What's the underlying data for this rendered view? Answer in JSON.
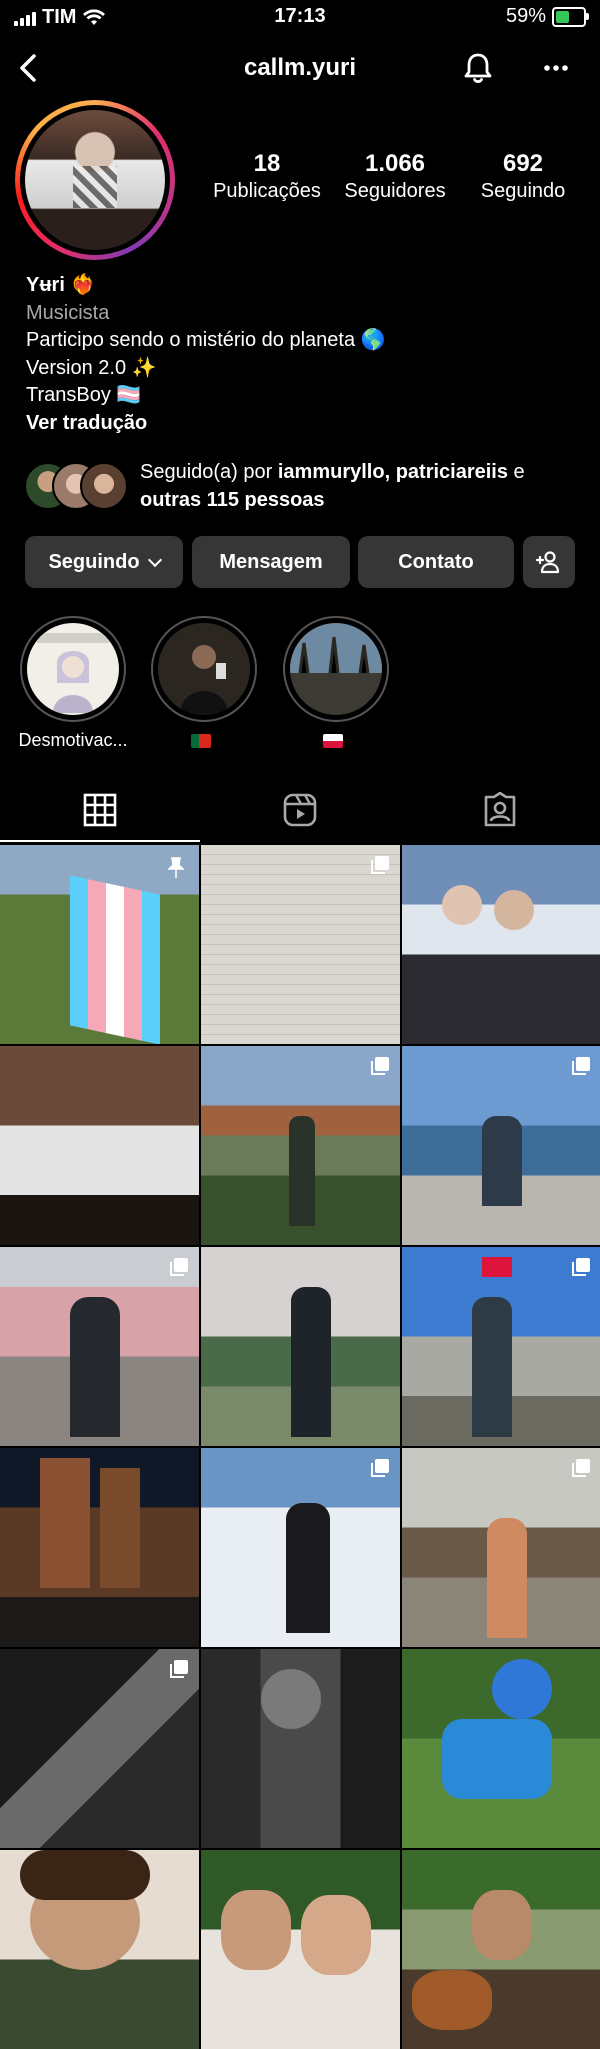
{
  "status_bar": {
    "carrier": "TIM",
    "time": "17:13",
    "battery": "59%",
    "battery_level": 0.59
  },
  "header": {
    "username": "callm.yuri",
    "icons": [
      "chevron-left-icon",
      "bell-icon",
      "more-icon"
    ]
  },
  "stats": {
    "posts": {
      "value": "18",
      "label": "Publicações"
    },
    "followers": {
      "value": "1.066",
      "label": "Seguidores"
    },
    "following": {
      "value": "692",
      "label": "Seguindo"
    }
  },
  "bio": {
    "name": "Yʉri",
    "name_emoji": "❤️‍🔥",
    "category": "Musicista",
    "line1": "Participo sendo o mistério do planeta 🌎",
    "line2": "Version 2.0 ✨",
    "line3": "TransBoy 🏳️‍⚧️",
    "translate": "Ver tradução"
  },
  "followed_by": {
    "prefix": "Seguido(a) por ",
    "names": "iammuryllo, patriciareiis",
    "middle": " e ",
    "others": "outras 115 pessoas"
  },
  "buttons": {
    "following": "Seguindo",
    "message": "Mensagem",
    "contact": "Contato"
  },
  "highlights": [
    {
      "label": "Desmotivac..."
    },
    {
      "label": "🇵🇹"
    },
    {
      "label": "🇵🇱"
    }
  ],
  "tabs": [
    "grid-icon",
    "reels-icon",
    "tagged-icon"
  ],
  "colors": {
    "background": "#000000",
    "button": "#363636",
    "secondary_text": "#a8a8a8",
    "battery_green": "#35c759"
  }
}
